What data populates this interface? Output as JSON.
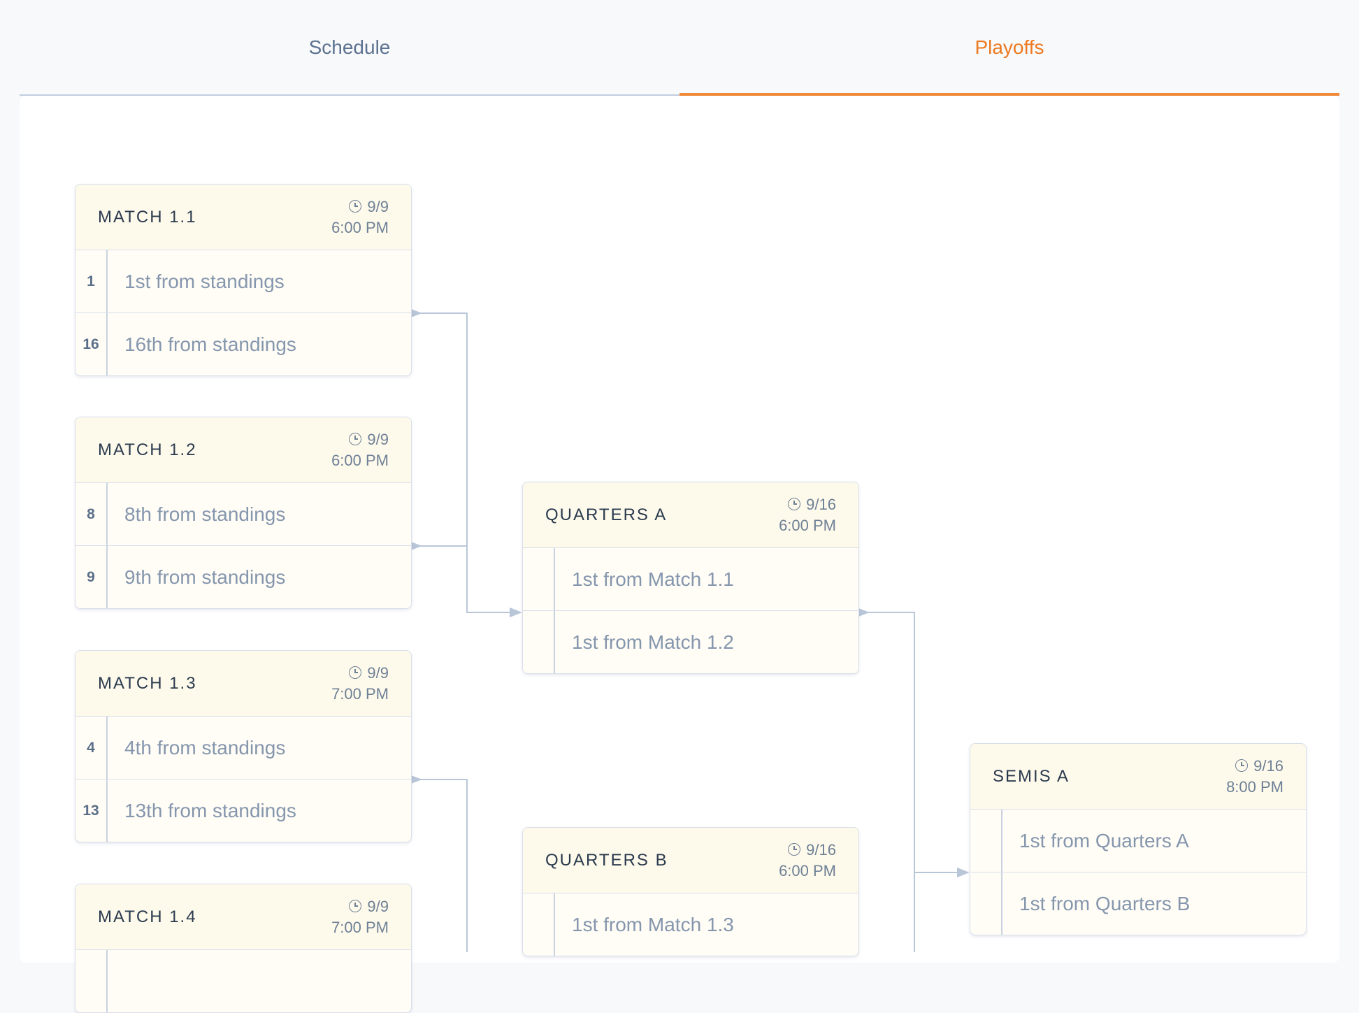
{
  "tabs": [
    {
      "label": "Schedule",
      "active": false
    },
    {
      "label": "Playoffs",
      "active": true
    }
  ],
  "colors": {
    "accent": "#ec7a22",
    "tab_inactive": "#5c7290",
    "connector": "#b9c6d8",
    "card_bg": "#fffdf6",
    "card_header_bg": "#fefaeb"
  },
  "icons": {
    "time": "clock-icon"
  },
  "matches": {
    "m11": {
      "title": "MATCH 1.1",
      "date": "9/9",
      "time": "6:00 PM",
      "slots": [
        {
          "seed": "1",
          "label": "1st from standings"
        },
        {
          "seed": "16",
          "label": "16th from standings"
        }
      ]
    },
    "m12": {
      "title": "MATCH 1.2",
      "date": "9/9",
      "time": "6:00 PM",
      "slots": [
        {
          "seed": "8",
          "label": "8th from standings"
        },
        {
          "seed": "9",
          "label": "9th from standings"
        }
      ]
    },
    "m13": {
      "title": "MATCH 1.3",
      "date": "9/9",
      "time": "7:00 PM",
      "slots": [
        {
          "seed": "4",
          "label": "4th from standings"
        },
        {
          "seed": "13",
          "label": "13th from standings"
        }
      ]
    },
    "m14": {
      "title": "MATCH 1.4",
      "date": "9/9",
      "time": "7:00 PM",
      "slots": [
        {
          "seed": "",
          "label": ""
        },
        {
          "seed": "",
          "label": ""
        }
      ]
    },
    "qa": {
      "title": "QUARTERS A",
      "date": "9/16",
      "time": "6:00 PM",
      "slots": [
        {
          "seed": "",
          "label": "1st from Match 1.1"
        },
        {
          "seed": "",
          "label": "1st from Match 1.2"
        }
      ]
    },
    "qb": {
      "title": "QUARTERS B",
      "date": "9/16",
      "time": "6:00 PM",
      "slots": [
        {
          "seed": "",
          "label": "1st from Match 1.3"
        },
        {
          "seed": "",
          "label": ""
        }
      ]
    },
    "sa": {
      "title": "SEMIS A",
      "date": "9/16",
      "time": "8:00 PM",
      "slots": [
        {
          "seed": "",
          "label": "1st from Quarters A"
        },
        {
          "seed": "",
          "label": "1st from Quarters B"
        }
      ]
    }
  }
}
